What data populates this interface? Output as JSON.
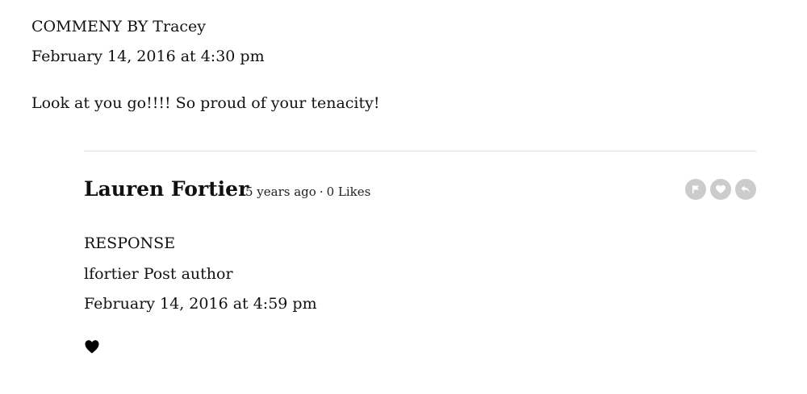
{
  "comment": {
    "author_line": "COMMENY BY Tracey",
    "date": "February 14, 2016 at 4:30 pm",
    "text": "Look at you go!!!! So proud of your tenacity!"
  },
  "reply": {
    "name": "Lauren Fortier",
    "time_ago": "5 years ago",
    "separator": "·",
    "likes": "0 Likes",
    "actions": {
      "flag_icon": "flag-icon",
      "like_icon": "heart-icon",
      "reply_icon": "reply-arrow-icon",
      "button_color": "#cccccc"
    },
    "label": "RESPONSE",
    "byline": "lfortier Post author",
    "date": "February 14, 2016 at 4:59 pm",
    "body_icon": "heart-icon"
  }
}
